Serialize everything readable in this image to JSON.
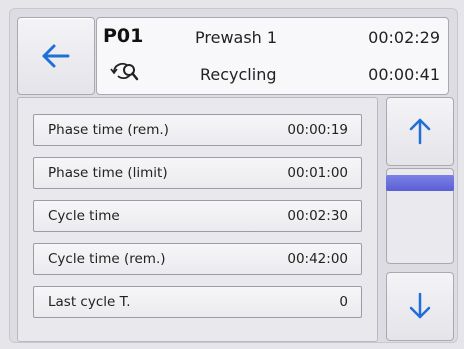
{
  "header": {
    "program_id": "P01",
    "program_name": "Prewash 1",
    "program_time": "00:02:29",
    "phase_name": "Recycling",
    "phase_time": "00:00:41"
  },
  "icons": {
    "back": "left-arrow-icon",
    "phase": "recycling-icon",
    "scroll_up": "up-arrow-icon",
    "scroll_down": "down-arrow-icon"
  },
  "rows": [
    {
      "label": "Phase time (rem.)",
      "value": "00:00:19"
    },
    {
      "label": "Phase time (limit)",
      "value": "00:01:00"
    },
    {
      "label": "Cycle time",
      "value": "00:02:30"
    },
    {
      "label": "Cycle time (rem.)",
      "value": "00:42:00"
    },
    {
      "label": "Last cycle T.",
      "value": "0"
    }
  ],
  "colors": {
    "accent_arrow": "#1f6fd8",
    "scroll_thumb": "#6a70dd"
  }
}
